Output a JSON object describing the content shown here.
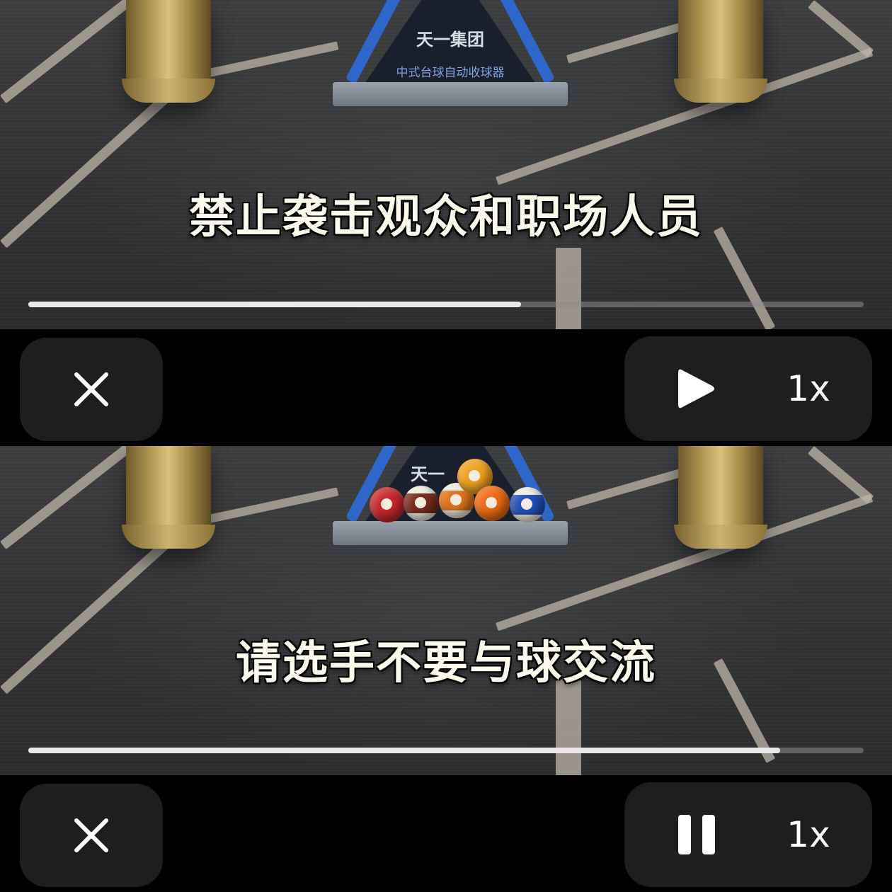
{
  "frames": [
    {
      "subtitle": "禁止袭击观众和职场人员",
      "rack_brand": "天一集团",
      "rack_caption": "中式台球自动收球器",
      "progress_fraction": 0.59,
      "has_balls": false,
      "controls": {
        "close_icon": "close-icon",
        "playback_state": "paused",
        "toggle_icon": "play-icon",
        "speed_label": "1x"
      }
    },
    {
      "subtitle": "请选手不要与球交流",
      "rack_brand": "天一",
      "progress_fraction": 0.9,
      "has_balls": true,
      "controls": {
        "close_icon": "close-icon",
        "playback_state": "playing",
        "toggle_icon": "pause-icon",
        "speed_label": "1x"
      }
    }
  ],
  "colors": {
    "controls_bg": "#000000",
    "button_bg": "#1e1e1e",
    "icon": "#ffffff",
    "subtitle": "#fbf8ec",
    "progress_fill": "#e9e9e9",
    "progress_track": "#8c8c8c",
    "rack_blue": "#2f66c9"
  }
}
